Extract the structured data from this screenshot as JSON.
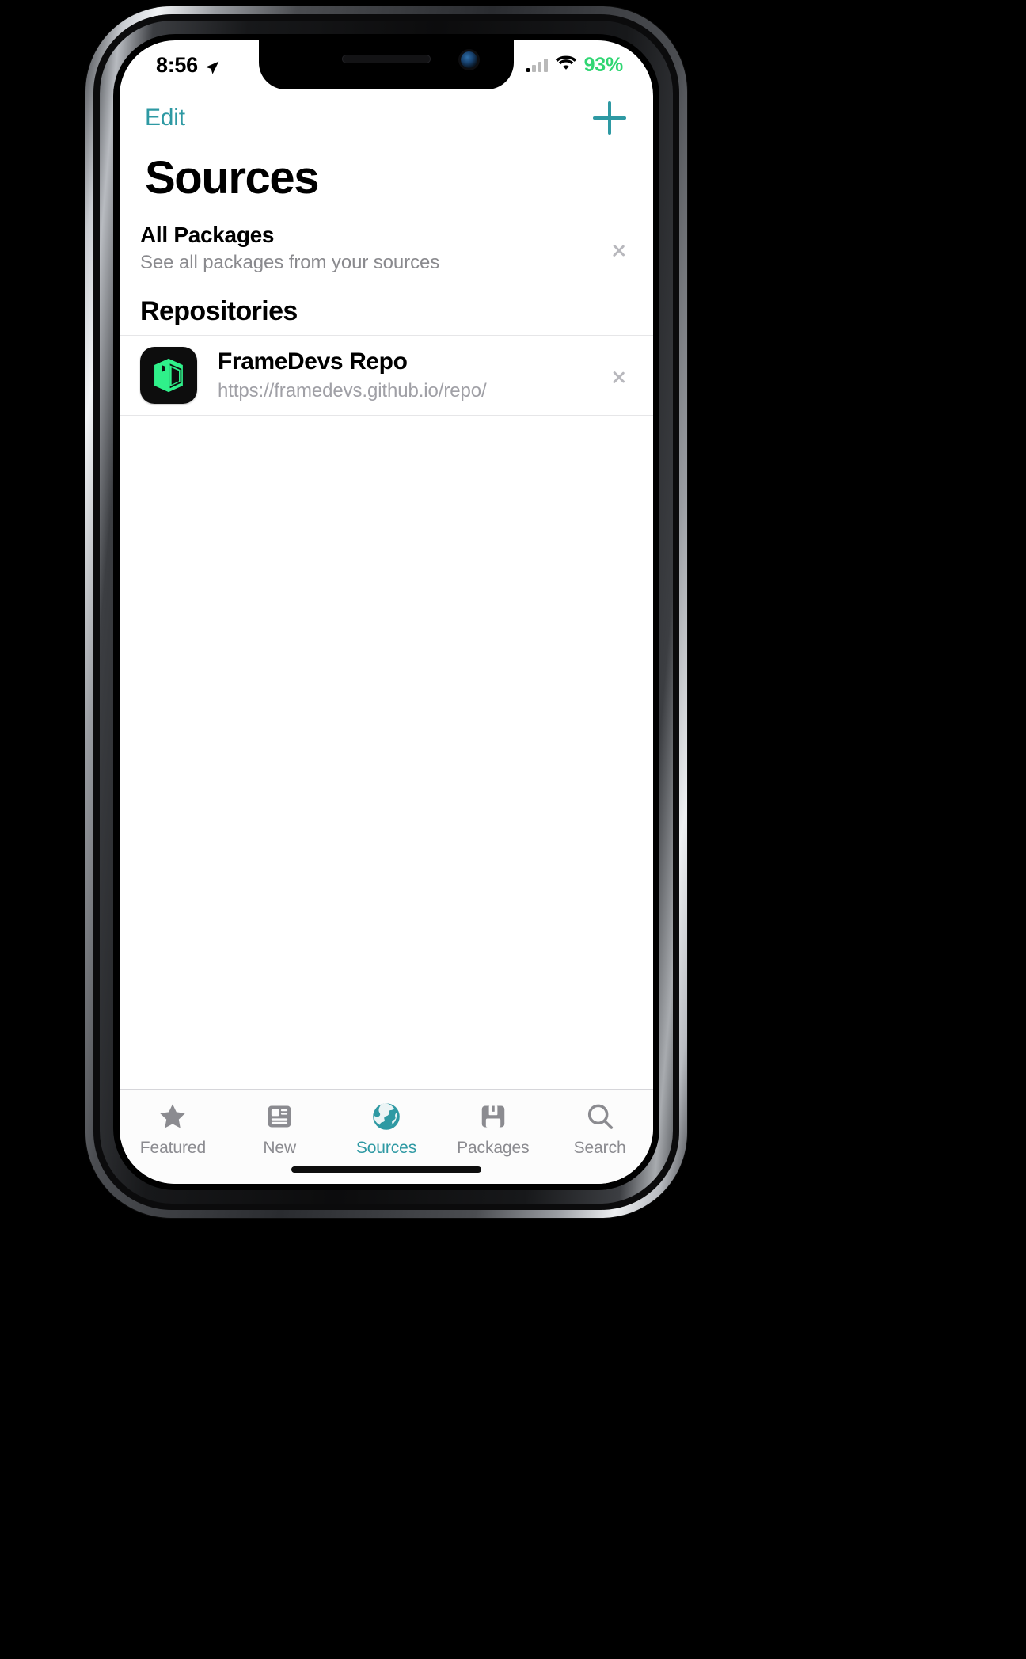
{
  "status_bar": {
    "time": "8:56",
    "location_icon": "location-arrow-icon",
    "signal_icon": "cellular-signal-icon",
    "wifi_icon": "wifi-icon",
    "battery_percent": "93%",
    "battery_color": "#2fd672"
  },
  "nav": {
    "edit_label": "Edit",
    "add_icon": "plus-icon",
    "accent_color": "#2e99a3"
  },
  "header": {
    "title": "Sources"
  },
  "all_packages": {
    "title": "All Packages",
    "subtitle": "See all packages from your sources",
    "chevron_icon": "chevron-right-icon"
  },
  "repositories": {
    "section_title": "Repositories",
    "items": [
      {
        "name": "FrameDevs Repo",
        "url": "https://framedevs.github.io/repo/",
        "icon": "framedevs-repo-icon",
        "icon_bg": "#0d0d0d",
        "icon_fg": "#2ff08a",
        "chevron_icon": "chevron-right-icon"
      }
    ]
  },
  "tabbar": {
    "items": [
      {
        "label": "Featured",
        "icon": "star-icon",
        "active": false
      },
      {
        "label": "New",
        "icon": "newspaper-icon",
        "active": false
      },
      {
        "label": "Sources",
        "icon": "globe-icon",
        "active": true
      },
      {
        "label": "Packages",
        "icon": "box-icon",
        "active": false
      },
      {
        "label": "Search",
        "icon": "search-icon",
        "active": false
      }
    ],
    "active_color": "#2e99a3",
    "inactive_color": "#8b8b90"
  }
}
